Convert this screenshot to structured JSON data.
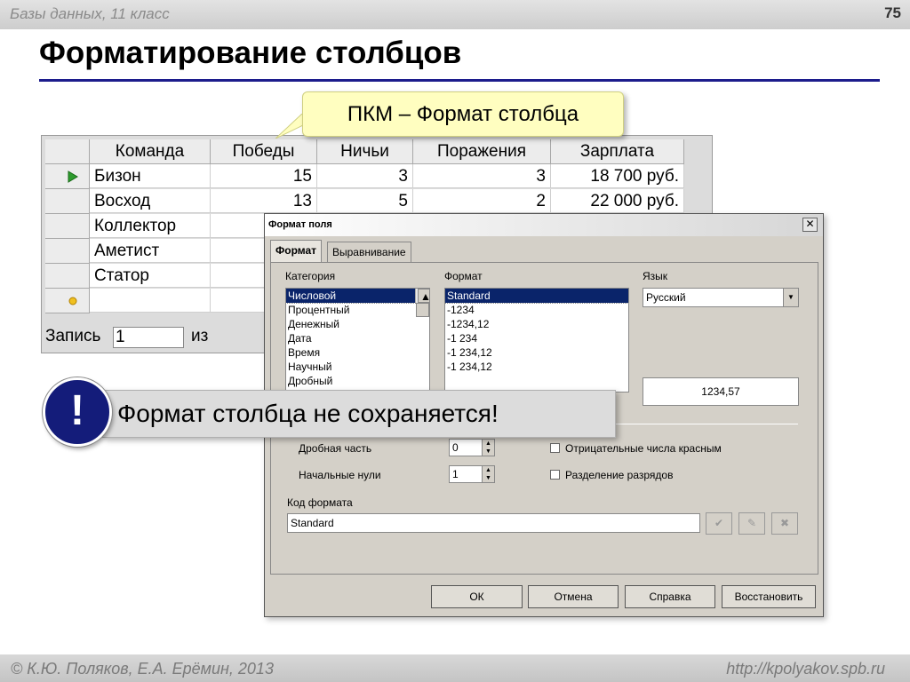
{
  "slide": {
    "course": "Базы данных, 11 класс",
    "page": "75",
    "title": "Форматирование столбцов",
    "authors": "© К.Ю. Поляков, Е.А. Ерёмин, 2013",
    "site": "http://kpolyakov.spb.ru"
  },
  "callout": "ПКМ – Формат столбца",
  "warning": {
    "text": "Формат столбца не сохраняется!",
    "mark": "!"
  },
  "grid": {
    "columns": [
      "Команда",
      "Победы",
      "Ничьи",
      "Поражения",
      "Зарплата"
    ],
    "rows": [
      {
        "team": "Бизон",
        "wins": "15",
        "draws": "3",
        "losses": "3",
        "salary": "18 700 руб."
      },
      {
        "team": "Восход",
        "wins": "13",
        "draws": "5",
        "losses": "2",
        "salary": "22 000 руб."
      },
      {
        "team": "Коллектор",
        "wins": "",
        "draws": "",
        "losses": "",
        "salary": ""
      },
      {
        "team": "Аметист",
        "wins": "",
        "draws": "",
        "losses": "",
        "salary": ""
      },
      {
        "team": "Статор",
        "wins": "",
        "draws": "",
        "losses": "",
        "salary": ""
      }
    ],
    "nav": {
      "record_label": "Запись",
      "record_value": "1",
      "of_label": "из"
    }
  },
  "dialog": {
    "title": "Формат поля",
    "close": "✕",
    "tabs": [
      "Формат",
      "Выравнивание"
    ],
    "category_label": "Категория",
    "categories": [
      "Числовой",
      "Процентный",
      "Денежный",
      "Дата",
      "Время",
      "Научный",
      "Дробный"
    ],
    "format_label": "Формат",
    "formats": [
      "Standard",
      "-1234",
      "-1234,12",
      "-1 234",
      "-1 234,12",
      "-1 234,12"
    ],
    "language_label": "Язык",
    "language_value": "Русский",
    "preview": "1234,57",
    "decimal_label": "Дробная часть",
    "decimal_value": "0",
    "leading_label": "Начальные нули",
    "leading_value": "1",
    "negative_red": "Отрицательные числа красным",
    "thousands": "Разделение разрядов",
    "code_label": "Код формата",
    "code_value": "Standard",
    "buttons": {
      "ok": "ОК",
      "cancel": "Отмена",
      "help": "Справка",
      "reset": "Восстановить"
    }
  }
}
